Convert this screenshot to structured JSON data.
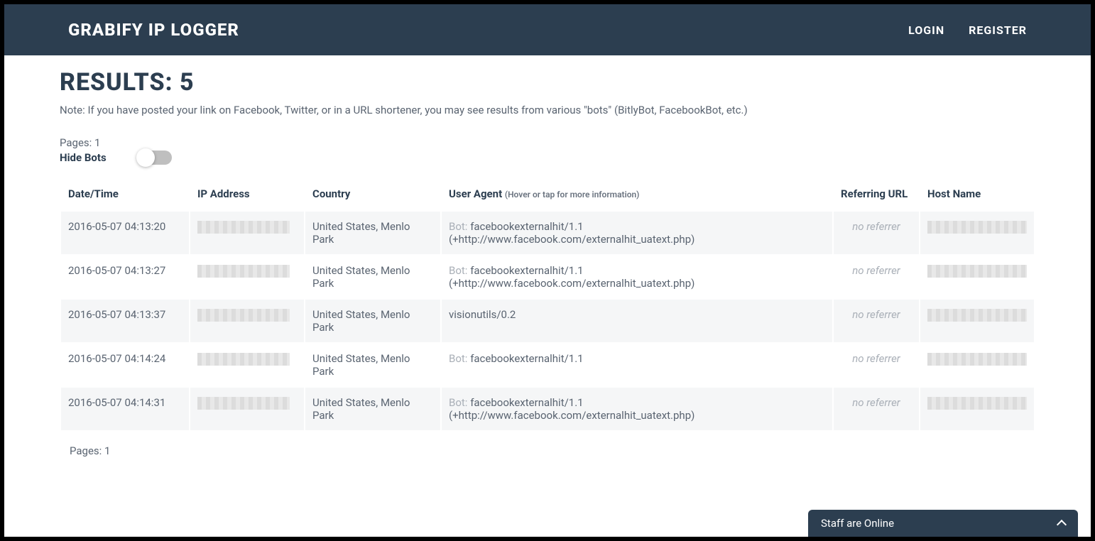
{
  "header": {
    "brand": "GRABIFY IP LOGGER",
    "login": "LOGIN",
    "register": "REGISTER"
  },
  "results": {
    "title": "RESULTS: 5",
    "note": "Note: If you have posted your link on Facebook, Twitter, or in a URL shortener, you may see results from various \"bots\" (BitlyBot, FacebookBot, etc.)",
    "pages_top": "Pages: 1",
    "hide_bots_label": "Hide Bots",
    "pages_bottom": "Pages: 1"
  },
  "table": {
    "headers": {
      "datetime": "Date/Time",
      "ip": "IP Address",
      "country": "Country",
      "useragent": "User Agent",
      "useragent_sub": "(Hover or tap for more information)",
      "refurl": "Referring URL",
      "hostname": "Host Name"
    },
    "rows": [
      {
        "datetime": "2016-05-07 04:13:20",
        "ip_redacted": true,
        "country": "United States, Menlo Park",
        "useragent_bot_prefix": "Bot:",
        "useragent": "facebookexternalhit/1.1 (+http://www.facebook.com/externalhit_uatext.php)",
        "refurl": "no referrer",
        "hostname_redacted": true
      },
      {
        "datetime": "2016-05-07 04:13:27",
        "ip_redacted": true,
        "country": "United States, Menlo Park",
        "useragent_bot_prefix": "Bot:",
        "useragent": "facebookexternalhit/1.1 (+http://www.facebook.com/externalhit_uatext.php)",
        "refurl": "no referrer",
        "hostname_redacted": true
      },
      {
        "datetime": "2016-05-07 04:13:37",
        "ip_redacted": true,
        "country": "United States, Menlo Park",
        "useragent_bot_prefix": "",
        "useragent": "visionutils/0.2",
        "refurl": "no referrer",
        "hostname_redacted": true
      },
      {
        "datetime": "2016-05-07 04:14:24",
        "ip_redacted": true,
        "country": "United States, Menlo Park",
        "useragent_bot_prefix": "Bot:",
        "useragent": "facebookexternalhit/1.1",
        "refurl": "no referrer",
        "hostname_redacted": true
      },
      {
        "datetime": "2016-05-07 04:14:31",
        "ip_redacted": true,
        "country": "United States, Menlo Park",
        "useragent_bot_prefix": "Bot:",
        "useragent": "facebookexternalhit/1.1 (+http://www.facebook.com/externalhit_uatext.php)",
        "refurl": "no referrer",
        "hostname_redacted": true
      }
    ]
  },
  "staff_bar": {
    "label": "Staff are Online"
  }
}
